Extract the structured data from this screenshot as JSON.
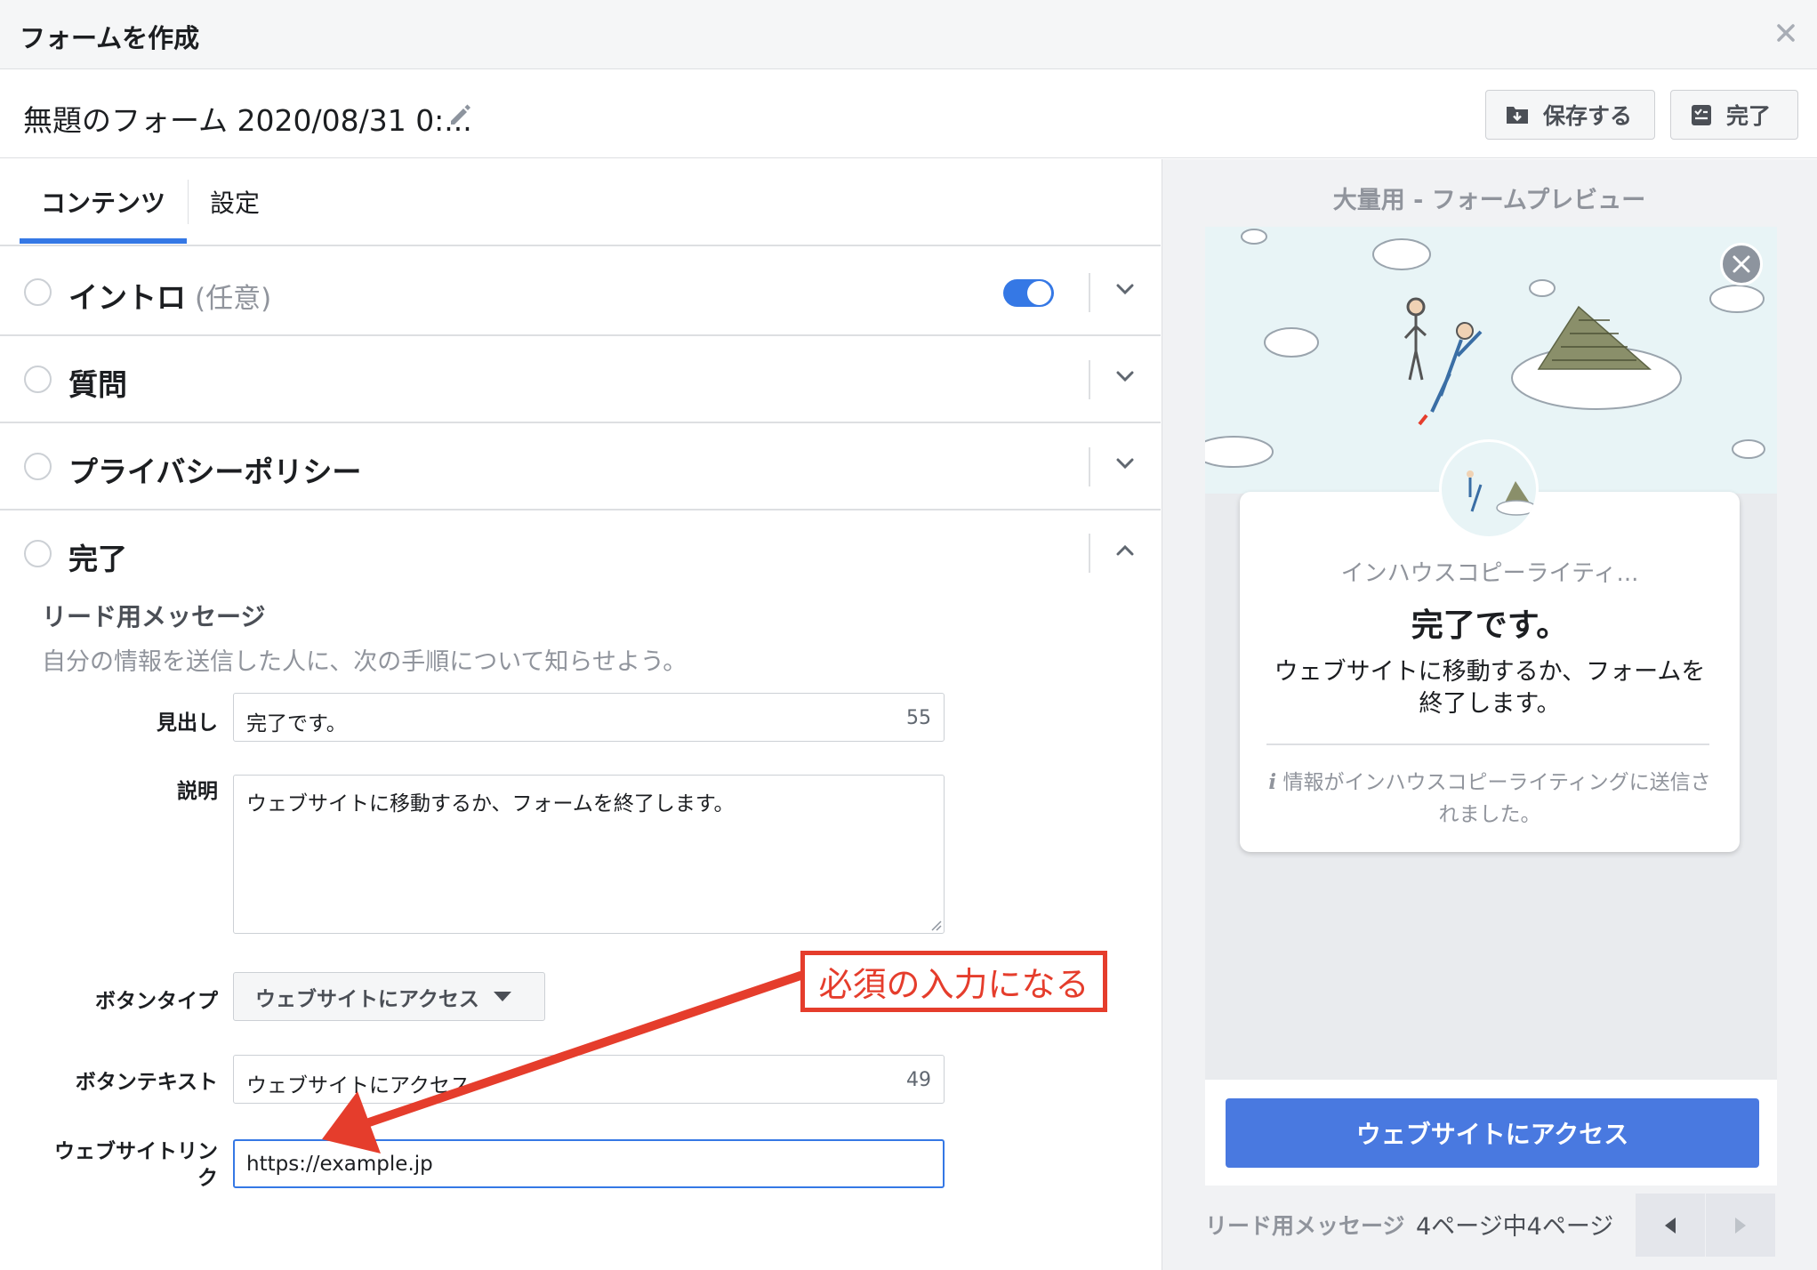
{
  "dialog": {
    "title": "フォームを作成",
    "close_icon": "close-icon"
  },
  "form_name": {
    "title": "無題のフォーム 2020/08/31 0:...",
    "edit_icon": "pencil-icon"
  },
  "header_actions": {
    "save_label": "保存する",
    "done_label": "完了"
  },
  "tabs": [
    {
      "label": "コンテンツ",
      "active": true
    },
    {
      "label": "設定",
      "active": false
    }
  ],
  "sections": [
    {
      "title": "イントロ",
      "optional": "(任意)",
      "toggle_on": true,
      "expanded": false
    },
    {
      "title": "質問",
      "expanded": false
    },
    {
      "title": "プライバシーポリシー",
      "expanded": false
    },
    {
      "title": "完了",
      "expanded": true
    }
  ],
  "completion": {
    "heading": "リード用メッセージ",
    "description": "自分の情報を送信した人に、次の手順について知らせよう。",
    "headline_label": "見出し",
    "headline_value": "完了です。",
    "headline_counter": "55",
    "desc_label": "説明",
    "desc_value": "ウェブサイトに移動するか、フォームを終了します。",
    "button_type_label": "ボタンタイプ",
    "button_type_value": "ウェブサイトにアクセス",
    "button_text_label": "ボタンテキスト",
    "button_text_value": "ウェブサイトにアクセス",
    "button_text_counter": "49",
    "website_link_label_1": "ウェブサイトリン",
    "website_link_label_2": "ク",
    "website_link_value": "https://example.jp"
  },
  "annotation": {
    "text": "必須の入力になる",
    "color": "#e53d2c"
  },
  "preview": {
    "title": "大量用 - フォームプレビュー",
    "company": "インハウスコピーライティ...",
    "headline": "完了です。",
    "description": "ウェブサイトに移動するか、フォームを終了します。",
    "note": "情報がインハウスコピーライティングに送信されました。",
    "cta": "ウェブサイトにアクセス",
    "pager_label": "リード用メッセージ",
    "pager_pages": "4ページ中4ページ"
  },
  "colors": {
    "accent": "#3578e5",
    "cta": "#4979e0",
    "annotation": "#e53d2c"
  }
}
